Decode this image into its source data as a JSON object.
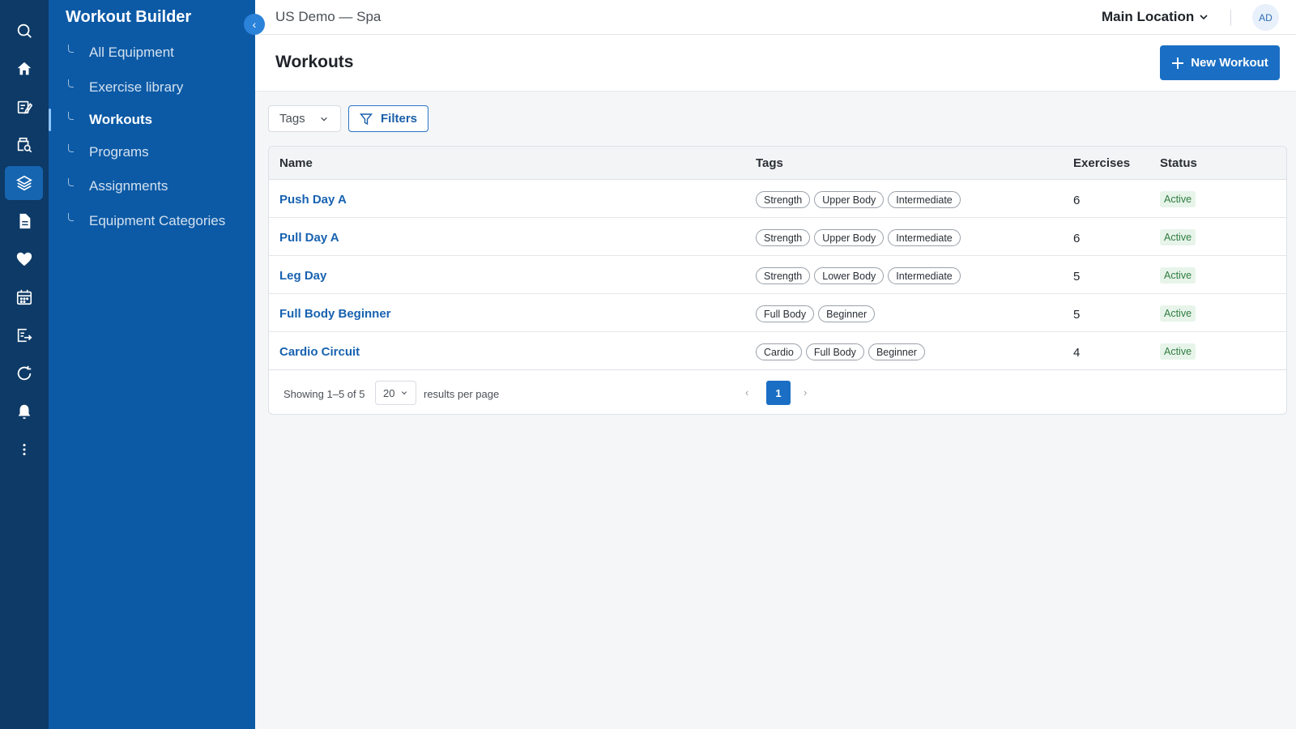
{
  "sidebar": {
    "title": "Workout Builder",
    "collapse_glyph": "‹",
    "items": [
      {
        "label": "All Equipment"
      },
      {
        "label": "Exercise library"
      },
      {
        "label": "Workouts"
      },
      {
        "label": "Programs"
      },
      {
        "label": "Assignments"
      },
      {
        "label": "Equipment Categories"
      }
    ]
  },
  "rail": {
    "icons": [
      "search-icon",
      "home-icon",
      "edit-note-icon",
      "inventory-search-icon",
      "layers-icon",
      "document-icon",
      "heart-icon",
      "calendar-icon",
      "export-icon",
      "refresh-icon",
      "bell-icon",
      "more-vertical-icon"
    ],
    "active_icon": "layers-icon"
  },
  "topbar": {
    "tenant": "US Demo — Spa",
    "location": "Main Location",
    "avatar_initials": "AD"
  },
  "page": {
    "title": "Workouts",
    "new_button": "New Workout"
  },
  "filters": {
    "tags_label": "Tags",
    "filters_label": "Filters"
  },
  "table": {
    "headers": {
      "name": "Name",
      "tags": "Tags",
      "exercises": "Exercises",
      "status": "Status"
    },
    "rows": [
      {
        "name": "Push Day A",
        "tags": [
          "Strength",
          "Upper Body",
          "Intermediate"
        ],
        "exercises": "6",
        "status": "Active"
      },
      {
        "name": "Pull Day A",
        "tags": [
          "Strength",
          "Upper Body",
          "Intermediate"
        ],
        "exercises": "6",
        "status": "Active"
      },
      {
        "name": "Leg Day",
        "tags": [
          "Strength",
          "Lower Body",
          "Intermediate"
        ],
        "exercises": "5",
        "status": "Active"
      },
      {
        "name": "Full Body Beginner",
        "tags": [
          "Full Body",
          "Beginner"
        ],
        "exercises": "5",
        "status": "Active"
      },
      {
        "name": "Cardio Circuit",
        "tags": [
          "Cardio",
          "Full Body",
          "Beginner"
        ],
        "exercises": "4",
        "status": "Active"
      }
    ]
  },
  "pagination": {
    "showing": "Showing 1–5 of 5",
    "per_page": "20",
    "per_page_label": "results per page",
    "current_page": "1",
    "prev_glyph": "‹",
    "next_glyph": "›"
  },
  "colors": {
    "rail": "#0d3a66",
    "sidebar": "#0c5aa6",
    "primary": "#1a6fc4",
    "link": "#1862b0",
    "status_bg": "#e7f4ea",
    "status_text": "#2f7d3f"
  }
}
